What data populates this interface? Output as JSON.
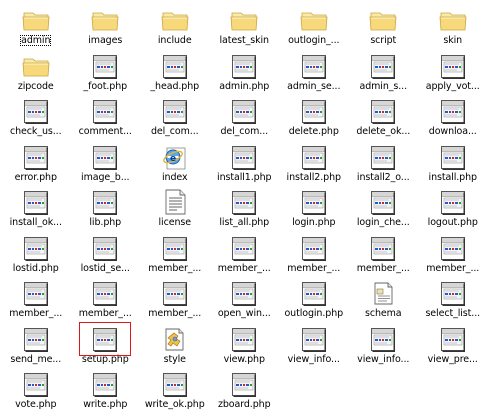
{
  "files": [
    {
      "name": "admin",
      "icon": "folder-icon"
    },
    {
      "name": "images",
      "icon": "folder-icon"
    },
    {
      "name": "include",
      "icon": "folder-icon"
    },
    {
      "name": "latest_skin",
      "icon": "folder-icon"
    },
    {
      "name": "outlogin_...",
      "icon": "folder-icon"
    },
    {
      "name": "script",
      "icon": "folder-icon"
    },
    {
      "name": "skin",
      "icon": "folder-icon"
    },
    {
      "name": "zipcode",
      "icon": "folder-icon"
    },
    {
      "name": "_foot.php",
      "icon": "php-file-icon"
    },
    {
      "name": "_head.php",
      "icon": "php-file-icon"
    },
    {
      "name": "admin.php",
      "icon": "php-file-icon"
    },
    {
      "name": "admin_se...",
      "icon": "php-file-icon"
    },
    {
      "name": "admin_s...",
      "icon": "php-file-icon"
    },
    {
      "name": "apply_vot...",
      "icon": "php-file-icon"
    },
    {
      "name": "check_us...",
      "icon": "php-file-icon"
    },
    {
      "name": "comment...",
      "icon": "php-file-icon"
    },
    {
      "name": "del_com...",
      "icon": "php-file-icon"
    },
    {
      "name": "del_com...",
      "icon": "php-file-icon"
    },
    {
      "name": "delete.php",
      "icon": "php-file-icon"
    },
    {
      "name": "delete_ok...",
      "icon": "php-file-icon"
    },
    {
      "name": "downloa...",
      "icon": "php-file-icon"
    },
    {
      "name": "error.php",
      "icon": "php-file-icon"
    },
    {
      "name": "image_b...",
      "icon": "php-file-icon"
    },
    {
      "name": "index",
      "icon": "internet-explorer-icon"
    },
    {
      "name": "install1.php",
      "icon": "php-file-icon"
    },
    {
      "name": "install2.php",
      "icon": "php-file-icon"
    },
    {
      "name": "install2_o...",
      "icon": "php-file-icon"
    },
    {
      "name": "install.php",
      "icon": "php-file-icon"
    },
    {
      "name": "install_ok...",
      "icon": "php-file-icon"
    },
    {
      "name": "lib.php",
      "icon": "php-file-icon"
    },
    {
      "name": "license",
      "icon": "text-file-icon"
    },
    {
      "name": "list_all.php",
      "icon": "php-file-icon"
    },
    {
      "name": "login.php",
      "icon": "php-file-icon"
    },
    {
      "name": "login_che...",
      "icon": "php-file-icon"
    },
    {
      "name": "logout.php",
      "icon": "php-file-icon"
    },
    {
      "name": "lostid.php",
      "icon": "php-file-icon"
    },
    {
      "name": "lostid_se...",
      "icon": "php-file-icon"
    },
    {
      "name": "member_...",
      "icon": "php-file-icon"
    },
    {
      "name": "member_...",
      "icon": "php-file-icon"
    },
    {
      "name": "member_...",
      "icon": "php-file-icon"
    },
    {
      "name": "member_...",
      "icon": "php-file-icon"
    },
    {
      "name": "member_...",
      "icon": "php-file-icon"
    },
    {
      "name": "member_...",
      "icon": "php-file-icon"
    },
    {
      "name": "member_...",
      "icon": "php-file-icon"
    },
    {
      "name": "member_...",
      "icon": "php-file-icon"
    },
    {
      "name": "open_win...",
      "icon": "php-file-icon"
    },
    {
      "name": "outlogin.php",
      "icon": "php-file-icon"
    },
    {
      "name": "schema",
      "icon": "schema-file-icon"
    },
    {
      "name": "select_list...",
      "icon": "php-file-icon"
    },
    {
      "name": "send_me...",
      "icon": "php-file-icon"
    },
    {
      "name": "setup.php",
      "icon": "php-file-icon",
      "selected": true
    },
    {
      "name": "style",
      "icon": "style-sheet-icon"
    },
    {
      "name": "view.php",
      "icon": "php-file-icon"
    },
    {
      "name": "view_info...",
      "icon": "php-file-icon"
    },
    {
      "name": "view_info...",
      "icon": "php-file-icon"
    },
    {
      "name": "view_pre...",
      "icon": "php-file-icon"
    },
    {
      "name": "vote.php",
      "icon": "php-file-icon"
    },
    {
      "name": "write.php",
      "icon": "php-file-icon"
    },
    {
      "name": "write_ok.php",
      "icon": "php-file-icon"
    },
    {
      "name": "zboard.php",
      "icon": "php-file-icon"
    }
  ],
  "focused_index": 0,
  "colors": {
    "folder": "#f7d97c",
    "folder_edge": "#c9a640",
    "selection_border": "#e01515",
    "label": "#000000"
  }
}
